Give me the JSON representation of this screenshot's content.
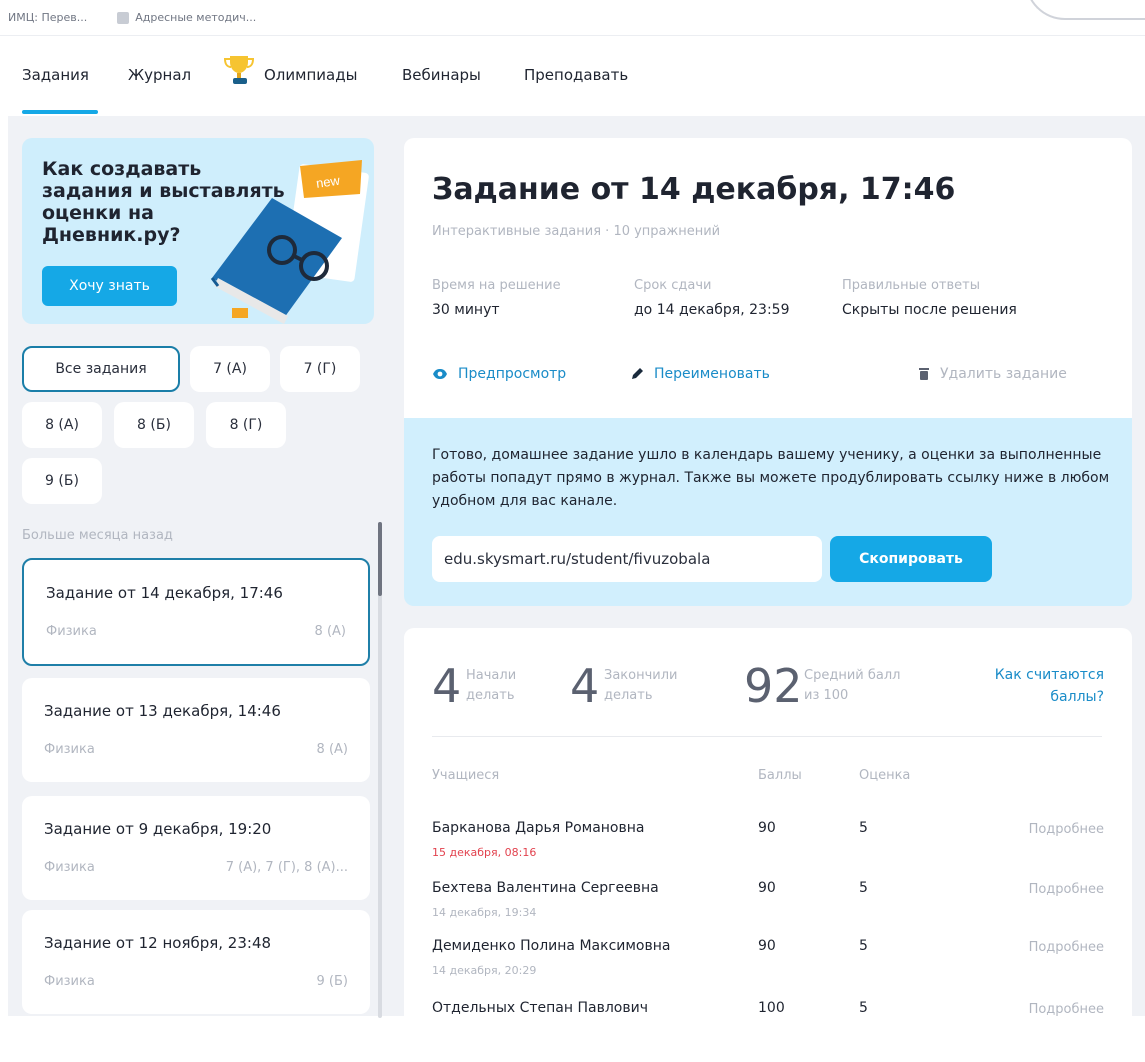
{
  "bookmarks": [
    "ИМЦ: Перев...",
    "Адресные методич..."
  ],
  "nav": {
    "tasks": "Задания",
    "journal": "Журнал",
    "olympiads": "Олимпиады",
    "webinars": "Вебинары",
    "teach": "Преподавать"
  },
  "promo": {
    "title": "Как создавать задания и выставлять оценки на Дневник.ру?",
    "badge": "new",
    "button": "Хочу знать"
  },
  "filters": [
    "Все задания",
    "7 (А)",
    "7 (Г)",
    "8 (А)",
    "8 (Б)",
    "8 (Г)",
    "9 (Б)"
  ],
  "section_label": "Больше месяца назад",
  "tasks": [
    {
      "title": "Задание от 14 декабря, 17:46",
      "subject": "Физика",
      "classes": "8 (А)"
    },
    {
      "title": "Задание от 13 декабря, 14:46",
      "subject": "Физика",
      "classes": "8 (А)"
    },
    {
      "title": "Задание от 9 декабря, 19:20",
      "subject": "Физика",
      "classes": "7 (А), 7 (Г), 8 (А)..."
    },
    {
      "title": "Задание от 12 ноября, 23:48",
      "subject": "Физика",
      "classes": "9 (Б)"
    }
  ],
  "main": {
    "title": "Задание от 14 декабря, 17:46",
    "subtitle": "Интерактивные задания · 10 упражнений",
    "time_label": "Время на решение",
    "time_value": "30 минут",
    "deadline_label": "Срок сдачи",
    "deadline_value": "до 14 декабря, 23:59",
    "answers_label": "Правильные ответы",
    "answers_value": "Скрыты после решения",
    "preview": "Предпросмотр",
    "rename": "Переименовать",
    "delete": "Удалить задание"
  },
  "notice": {
    "text": "Готово, домашнее задание ушло в календарь вашему ученику, а оценки за выполненные работы попадут прямо в журнал. Также вы можете продублировать ссылку ниже в любом удобном для вас канале.",
    "link": "edu.skysmart.ru/student/fivuzobala",
    "copy": "Скопировать"
  },
  "stats": {
    "started_num": "4",
    "started_label": "Начали делать",
    "finished_num": "4",
    "finished_label": "Закончили делать",
    "avg_num": "92",
    "avg_label": "Средний балл из 100",
    "how_link": "Как считаются баллы?"
  },
  "table": {
    "headers": {
      "student": "Учащиеся",
      "score": "Баллы",
      "grade": "Оценка"
    },
    "more_label": "Подробнее",
    "rows": [
      {
        "name": "Барканова Дарья Романовна",
        "date": "15 декабря, 08:16",
        "late": true,
        "score": "90",
        "grade": "5"
      },
      {
        "name": "Бехтева Валентина Сергеевна",
        "date": "14 декабря, 19:34",
        "late": false,
        "score": "90",
        "grade": "5"
      },
      {
        "name": "Демиденко Полина Максимовна",
        "date": "14 декабря, 20:29",
        "late": false,
        "score": "90",
        "grade": "5"
      },
      {
        "name": "Отдельных Степан Павлович",
        "date": "",
        "late": false,
        "score": "100",
        "grade": "5"
      }
    ]
  },
  "colors": {
    "accent": "#15a8e6",
    "link": "#1a8cc8",
    "late": "#e2424e",
    "promo_bg": "#cfeefc",
    "notice_bg": "#d1effd"
  }
}
